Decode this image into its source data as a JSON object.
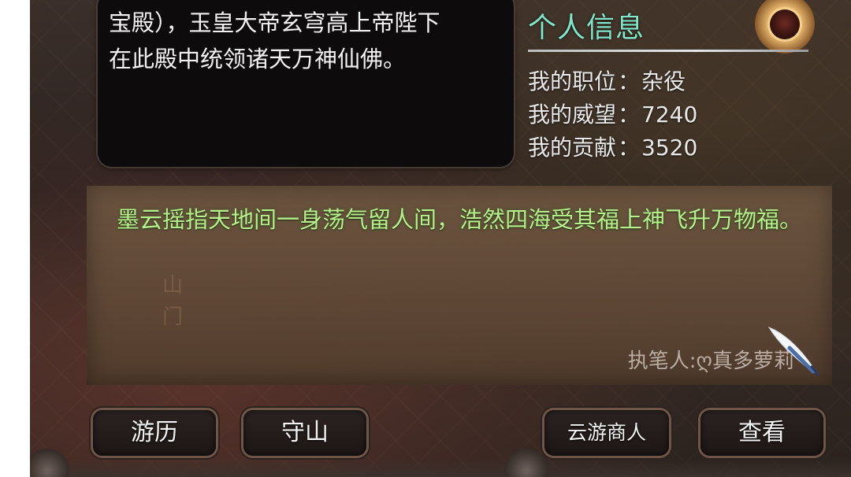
{
  "story": {
    "lines": [
      "宝殿），玉皇大帝玄穹高上帝陛下",
      "在此殿中统领诸天万神仙佛。"
    ]
  },
  "profile": {
    "title": "个人信息",
    "position_label": "我的职位",
    "position_value": "杂役",
    "prestige_label": "我的威望",
    "prestige_value": "7240",
    "contribution_label": "我的贡献",
    "contribution_value": "3520",
    "separator": "："
  },
  "inscription": {
    "text": "墨云摇指天地间一身荡气留人间，浩然四海受其福上神飞升万物福。",
    "background_chars": [
      "山",
      "门"
    ],
    "author": "执笔人:ღ真多萝莉"
  },
  "buttons": {
    "travel": "游历",
    "guard": "守山",
    "merchant": "云游商人",
    "view": "查看"
  },
  "colors": {
    "title_accent": "#7fe6c8",
    "inscription_text": "#b8ef8e",
    "panel_dark": "#0d0b0b"
  },
  "icons": [
    "quill-icon",
    "avatar-portrait"
  ]
}
